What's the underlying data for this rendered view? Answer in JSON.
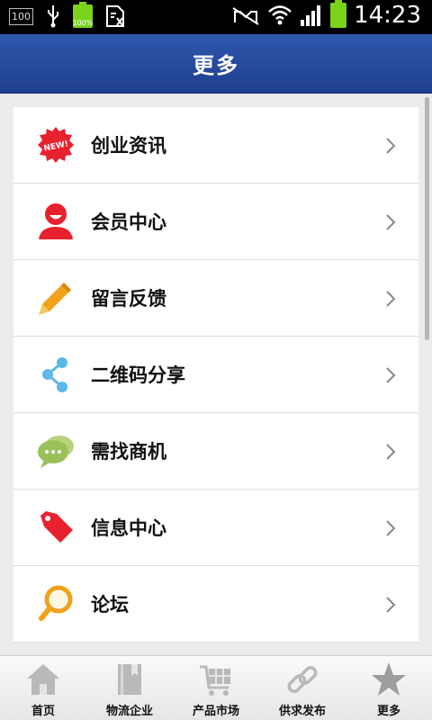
{
  "status_bar": {
    "sim_label": "100",
    "battery_small_label": "100%",
    "time": "14:23"
  },
  "header": {
    "title": "更多"
  },
  "menu": {
    "items": [
      {
        "label": "创业资讯",
        "icon": "new-badge-icon"
      },
      {
        "label": "会员中心",
        "icon": "member-icon"
      },
      {
        "label": "留言反馈",
        "icon": "pencil-icon"
      },
      {
        "label": "二维码分享",
        "icon": "share-icon"
      },
      {
        "label": "需找商机",
        "icon": "chat-bubble-icon"
      },
      {
        "label": "信息中心",
        "icon": "tag-icon"
      },
      {
        "label": "论坛",
        "icon": "magnifier-icon"
      }
    ],
    "new_badge_text": "NEW!"
  },
  "tabbar": {
    "tabs": [
      {
        "label": "首页",
        "icon": "home-icon"
      },
      {
        "label": "物流企业",
        "icon": "book-icon"
      },
      {
        "label": "产品市场",
        "icon": "cart-icon"
      },
      {
        "label": "供求发布",
        "icon": "link-icon"
      },
      {
        "label": "更多",
        "icon": "star-icon"
      }
    ]
  },
  "colors": {
    "header": "#2a4fa3",
    "red": "#e8212f",
    "orange": "#f0a21b",
    "blue": "#5cb8e6",
    "green": "#9ac05a",
    "battery": "#7bd31b"
  }
}
